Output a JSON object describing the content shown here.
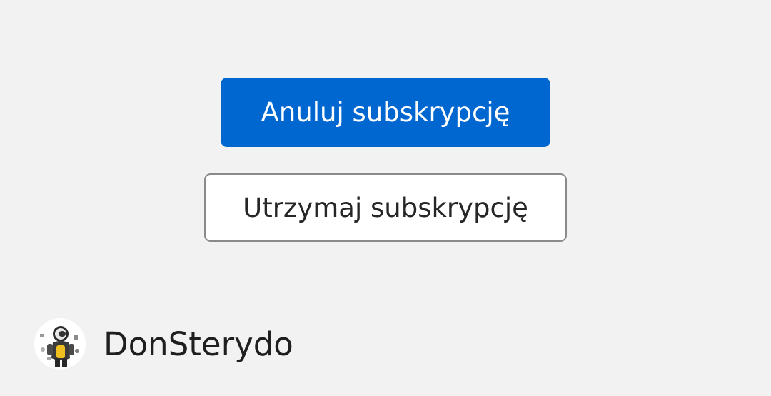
{
  "dialog": {
    "cancel_label": "Anuluj subskrypcję",
    "keep_label": "Utrzymaj subskrypcję"
  },
  "author": {
    "name": "DonSterydo",
    "avatar_icon": "astronaut-avatar-icon"
  },
  "colors": {
    "background": "#f2f2f2",
    "primary": "#0067d1",
    "secondary_border": "#8a8a8a",
    "text": "#1f1f1f"
  }
}
